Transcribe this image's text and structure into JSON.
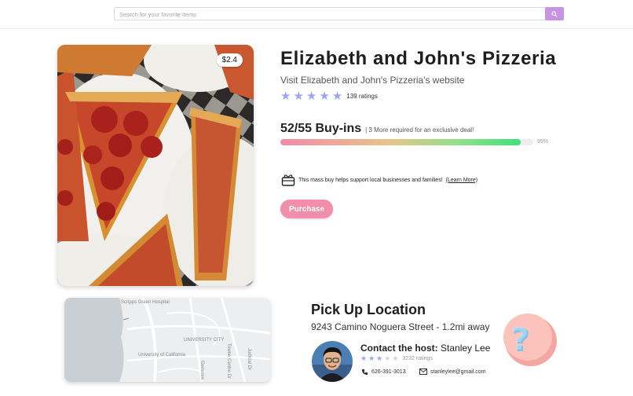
{
  "search": {
    "placeholder": "Search for your favorite items",
    "button_icon": "search-icon"
  },
  "product": {
    "price_tag": "$2.4",
    "title": "Elizabeth and John's Pizzeria",
    "website_link": "Visit Elizabeth and John's Pizzeria's website",
    "rating_stars": 5,
    "ratings_text": "139 ratings",
    "buyins_count": "52/55 Buy-ins",
    "buyins_note": "| 3 More required for an exclusive deal!",
    "progress_percent": 95,
    "progress_text": "95%",
    "support_text": "This mass buy helps support local businesses and families!",
    "learn_more": "(Learn More)",
    "purchase_label": "Purchase"
  },
  "map": {
    "labels": {
      "hospital": "Scripps Green Hospital",
      "university_city": "UNIVERSITY CITY",
      "ucsd": "University of California",
      "street_a": "Genesee",
      "street_b": "Towne Centre Dr",
      "street_c": "Judicial Dr"
    }
  },
  "pickup": {
    "title": "Pick Up Location",
    "address": "9243 Camino Noguera Street - 1.2mi away",
    "host_label": "Contact the host:",
    "host_name": "Stanley Lee",
    "host_rating_stars": 3,
    "host_ratings_text": "3232 ratings",
    "phone": "626-391-3013",
    "email": "stanleylee@gmail.com"
  },
  "colors": {
    "accent_purple": "#c793e3",
    "star": "#9ea5ee",
    "purchase_pink": "#f08eab",
    "progress_start": "#f28aa8",
    "progress_end": "#3ee07a"
  }
}
